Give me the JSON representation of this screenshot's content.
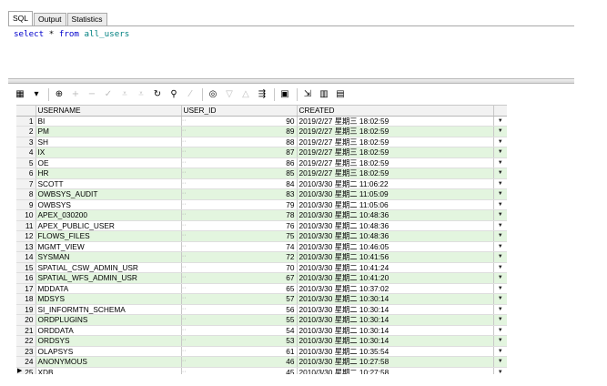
{
  "tabs": [
    {
      "label": "SQL"
    },
    {
      "label": "Output"
    },
    {
      "label": "Statistics"
    }
  ],
  "editor": {
    "text": "select * from all_users"
  },
  "columns": [
    "USERNAME",
    "USER_ID",
    "CREATED"
  ],
  "dropdown_glyph": "···",
  "rows": [
    {
      "n": "1",
      "username": "BI",
      "user_id": "90",
      "created": "2019/2/27 星期三 18:02:59"
    },
    {
      "n": "2",
      "username": "PM",
      "user_id": "89",
      "created": "2019/2/27 星期三 18:02:59"
    },
    {
      "n": "3",
      "username": "SH",
      "user_id": "88",
      "created": "2019/2/27 星期三 18:02:59"
    },
    {
      "n": "4",
      "username": "IX",
      "user_id": "87",
      "created": "2019/2/27 星期三 18:02:59"
    },
    {
      "n": "5",
      "username": "OE",
      "user_id": "86",
      "created": "2019/2/27 星期三 18:02:59"
    },
    {
      "n": "6",
      "username": "HR",
      "user_id": "85",
      "created": "2019/2/27 星期三 18:02:59"
    },
    {
      "n": "7",
      "username": "SCOTT",
      "user_id": "84",
      "created": "2010/3/30 星期二 11:06:22"
    },
    {
      "n": "8",
      "username": "OWBSYS_AUDIT",
      "user_id": "83",
      "created": "2010/3/30 星期二 11:05:09"
    },
    {
      "n": "9",
      "username": "OWBSYS",
      "user_id": "79",
      "created": "2010/3/30 星期二 11:05:06"
    },
    {
      "n": "10",
      "username": "APEX_030200",
      "user_id": "78",
      "created": "2010/3/30 星期二 10:48:36"
    },
    {
      "n": "11",
      "username": "APEX_PUBLIC_USER",
      "user_id": "76",
      "created": "2010/3/30 星期二 10:48:36"
    },
    {
      "n": "12",
      "username": "FLOWS_FILES",
      "user_id": "75",
      "created": "2010/3/30 星期二 10:48:36"
    },
    {
      "n": "13",
      "username": "MGMT_VIEW",
      "user_id": "74",
      "created": "2010/3/30 星期二 10:46:05"
    },
    {
      "n": "14",
      "username": "SYSMAN",
      "user_id": "72",
      "created": "2010/3/30 星期二 10:41:56"
    },
    {
      "n": "15",
      "username": "SPATIAL_CSW_ADMIN_USR",
      "user_id": "70",
      "created": "2010/3/30 星期二 10:41:24"
    },
    {
      "n": "16",
      "username": "SPATIAL_WFS_ADMIN_USR",
      "user_id": "67",
      "created": "2010/3/30 星期二 10:41:20"
    },
    {
      "n": "17",
      "username": "MDDATA",
      "user_id": "65",
      "created": "2010/3/30 星期二 10:37:02"
    },
    {
      "n": "18",
      "username": "MDSYS",
      "user_id": "57",
      "created": "2010/3/30 星期二 10:30:14"
    },
    {
      "n": "19",
      "username": "SI_INFORMTN_SCHEMA",
      "user_id": "56",
      "created": "2010/3/30 星期二 10:30:14"
    },
    {
      "n": "20",
      "username": "ORDPLUGINS",
      "user_id": "55",
      "created": "2010/3/30 星期二 10:30:14"
    },
    {
      "n": "21",
      "username": "ORDDATA",
      "user_id": "54",
      "created": "2010/3/30 星期二 10:30:14"
    },
    {
      "n": "22",
      "username": "ORDSYS",
      "user_id": "53",
      "created": "2010/3/30 星期二 10:30:14"
    },
    {
      "n": "23",
      "username": "OLAPSYS",
      "user_id": "61",
      "created": "2010/3/30 星期二 10:35:54"
    },
    {
      "n": "24",
      "username": "ANONYMOUS",
      "user_id": "46",
      "created": "2010/3/30 星期二 10:27:58"
    },
    {
      "n": "25",
      "username": "XDB",
      "user_id": "45",
      "created": "2010/3/30 星期二 10:27:58"
    }
  ],
  "toolbar": [
    {
      "icon": "grid-icon",
      "glyph": "▦"
    },
    {
      "icon": "dropdown-icon",
      "glyph": "▾"
    },
    {
      "icon": "lock-icon",
      "glyph": "⊕"
    },
    {
      "icon": "add-icon",
      "glyph": "+"
    },
    {
      "icon": "remove-icon",
      "glyph": "−"
    },
    {
      "icon": "post-icon",
      "glyph": "✓"
    },
    {
      "icon": "filter-icon",
      "glyph": "⩡"
    },
    {
      "icon": "filter-clear-icon",
      "glyph": "⩡"
    },
    {
      "icon": "refresh-icon",
      "glyph": "↻"
    },
    {
      "icon": "find-icon",
      "glyph": "⚲"
    },
    {
      "icon": "clear-icon",
      "glyph": "⁄"
    },
    {
      "icon": "query-by-example-icon",
      "glyph": "◎"
    },
    {
      "icon": "next-icon",
      "glyph": "▽"
    },
    {
      "icon": "prev-icon",
      "glyph": "△"
    },
    {
      "icon": "import-icon",
      "glyph": "⇶"
    },
    {
      "icon": "save-icon",
      "glyph": "▣"
    },
    {
      "icon": "export-icon",
      "glyph": "⇲"
    },
    {
      "icon": "chart-icon",
      "glyph": "▥"
    },
    {
      "icon": "table-icon",
      "glyph": "▤"
    }
  ],
  "colors": {
    "keyword": "#0000cc",
    "identifier": "#008080",
    "row_alt": "#e3f5df"
  }
}
